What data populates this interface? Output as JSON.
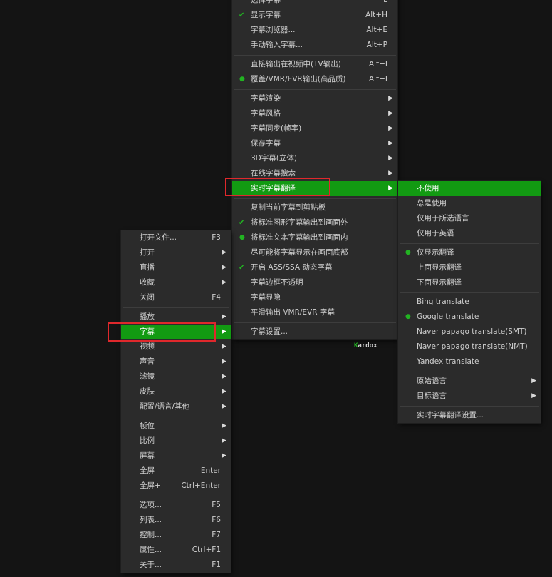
{
  "main_menu": {
    "items": [
      {
        "type": "item",
        "label": "打开文件...",
        "shortcut": "F3",
        "submenu": false,
        "name": "open-file"
      },
      {
        "type": "item",
        "label": "打开",
        "shortcut": "",
        "submenu": true,
        "name": "open"
      },
      {
        "type": "item",
        "label": "直播",
        "shortcut": "",
        "submenu": true,
        "name": "live"
      },
      {
        "type": "item",
        "label": "收藏",
        "shortcut": "",
        "submenu": true,
        "name": "favorites"
      },
      {
        "type": "item",
        "label": "关闭",
        "shortcut": "F4",
        "submenu": false,
        "name": "close"
      },
      {
        "type": "sep"
      },
      {
        "type": "item",
        "label": "播放",
        "shortcut": "",
        "submenu": true,
        "name": "playback"
      },
      {
        "type": "item",
        "label": "字幕",
        "shortcut": "",
        "submenu": true,
        "highlighted": true,
        "name": "subtitles"
      },
      {
        "type": "item",
        "label": "视频",
        "shortcut": "",
        "submenu": true,
        "name": "video"
      },
      {
        "type": "item",
        "label": "声音",
        "shortcut": "",
        "submenu": true,
        "name": "audio"
      },
      {
        "type": "item",
        "label": "滤镜",
        "shortcut": "",
        "submenu": true,
        "name": "filters"
      },
      {
        "type": "item",
        "label": "皮肤",
        "shortcut": "",
        "submenu": true,
        "name": "skins"
      },
      {
        "type": "item",
        "label": "配置/语言/其他",
        "shortcut": "",
        "submenu": true,
        "name": "config-language-other"
      },
      {
        "type": "sep"
      },
      {
        "type": "item",
        "label": "帧位",
        "shortcut": "",
        "submenu": true,
        "name": "frame-position"
      },
      {
        "type": "item",
        "label": "比例",
        "shortcut": "",
        "submenu": true,
        "name": "aspect-ratio"
      },
      {
        "type": "item",
        "label": "屏幕",
        "shortcut": "",
        "submenu": true,
        "name": "screen"
      },
      {
        "type": "item",
        "label": "全屏",
        "shortcut": "Enter",
        "submenu": false,
        "name": "fullscreen"
      },
      {
        "type": "item",
        "label": "全屏+",
        "shortcut": "Ctrl+Enter",
        "submenu": false,
        "name": "fullscreen-plus"
      },
      {
        "type": "sep"
      },
      {
        "type": "item",
        "label": "选项...",
        "shortcut": "F5",
        "submenu": false,
        "name": "options"
      },
      {
        "type": "item",
        "label": "列表...",
        "shortcut": "F6",
        "submenu": false,
        "name": "playlist"
      },
      {
        "type": "item",
        "label": "控制...",
        "shortcut": "F7",
        "submenu": false,
        "name": "control"
      },
      {
        "type": "item",
        "label": "属性...",
        "shortcut": "Ctrl+F1",
        "submenu": false,
        "name": "properties"
      },
      {
        "type": "item",
        "label": "关于...",
        "shortcut": "F1",
        "submenu": false,
        "name": "about"
      }
    ]
  },
  "subtitle_menu": {
    "items": [
      {
        "type": "item",
        "label": "选择字幕",
        "shortcut": "L",
        "submenu": false,
        "name": "select-subtitle"
      },
      {
        "type": "item",
        "label": "显示字幕",
        "shortcut": "Alt+H",
        "submenu": false,
        "marker": "check",
        "name": "show-subtitles"
      },
      {
        "type": "item",
        "label": "字幕浏览器...",
        "shortcut": "Alt+E",
        "submenu": false,
        "name": "subtitle-browser"
      },
      {
        "type": "item",
        "label": "手动输入字幕...",
        "shortcut": "Alt+P",
        "submenu": false,
        "name": "manual-subtitle-input"
      },
      {
        "type": "sep"
      },
      {
        "type": "item",
        "label": "直接输出在视频中(TV输出)",
        "shortcut": "Alt+I",
        "submenu": false,
        "name": "direct-output-tv"
      },
      {
        "type": "item",
        "label": "覆盖/VMR/EVR输出(高品质)",
        "shortcut": "Alt+I",
        "submenu": false,
        "marker": "dot",
        "name": "overlay-vmr-evr-output"
      },
      {
        "type": "sep"
      },
      {
        "type": "item",
        "label": "字幕渲染",
        "shortcut": "",
        "submenu": true,
        "name": "subtitle-rendering"
      },
      {
        "type": "item",
        "label": "字幕风格",
        "shortcut": "",
        "submenu": true,
        "name": "subtitle-style"
      },
      {
        "type": "item",
        "label": "字幕同步(帧率)",
        "shortcut": "",
        "submenu": true,
        "name": "subtitle-sync"
      },
      {
        "type": "item",
        "label": "保存字幕",
        "shortcut": "",
        "submenu": true,
        "name": "save-subtitle"
      },
      {
        "type": "item",
        "label": "3D字幕(立体)",
        "shortcut": "",
        "submenu": true,
        "name": "subtitle-3d"
      },
      {
        "type": "item",
        "label": "在线字幕搜索",
        "shortcut": "",
        "submenu": true,
        "name": "online-subtitle-search"
      },
      {
        "type": "item",
        "label": "实时字幕翻译",
        "shortcut": "",
        "submenu": true,
        "highlighted": true,
        "name": "realtime-subtitle-translation"
      },
      {
        "type": "sep"
      },
      {
        "type": "item",
        "label": "复制当前字幕到剪贴板",
        "shortcut": "",
        "submenu": false,
        "name": "copy-subtitle-clipboard"
      },
      {
        "type": "item",
        "label": "将标准图形字幕输出到画面外",
        "shortcut": "",
        "submenu": false,
        "marker": "check",
        "name": "graphic-subtitle-outside"
      },
      {
        "type": "item",
        "label": "将标准文本字幕输出到画面内",
        "shortcut": "",
        "submenu": false,
        "marker": "dot",
        "name": "text-subtitle-inside"
      },
      {
        "type": "item",
        "label": "尽可能将字幕显示在画面底部",
        "shortcut": "",
        "submenu": false,
        "name": "subtitle-at-bottom"
      },
      {
        "type": "item",
        "label": "开启 ASS/SSA 动态字幕",
        "shortcut": "",
        "submenu": false,
        "marker": "check",
        "name": "ass-ssa-dynamic"
      },
      {
        "type": "item",
        "label": "字幕边框不透明",
        "shortcut": "",
        "submenu": false,
        "name": "opaque-subtitle-border"
      },
      {
        "type": "item",
        "label": "字幕显隐",
        "shortcut": "",
        "submenu": false,
        "name": "subtitle-fade"
      },
      {
        "type": "item",
        "label": "平滑输出 VMR/EVR 字幕",
        "shortcut": "",
        "submenu": false,
        "name": "smooth-vmr-evr-subtitle"
      },
      {
        "type": "sep"
      },
      {
        "type": "item",
        "label": "字幕设置...",
        "shortcut": "",
        "submenu": false,
        "name": "subtitle-settings"
      }
    ]
  },
  "translate_menu": {
    "items": [
      {
        "type": "item",
        "label": "不使用",
        "shortcut": "",
        "submenu": false,
        "highlighted": true,
        "name": "not-used"
      },
      {
        "type": "item",
        "label": "总是使用",
        "shortcut": "",
        "submenu": false,
        "name": "always-use"
      },
      {
        "type": "item",
        "label": "仅用于所选语言",
        "shortcut": "",
        "submenu": false,
        "name": "selected-language-only"
      },
      {
        "type": "item",
        "label": "仅用于英语",
        "shortcut": "",
        "submenu": false,
        "name": "english-only"
      },
      {
        "type": "sep"
      },
      {
        "type": "item",
        "label": "仅显示翻译",
        "shortcut": "",
        "submenu": false,
        "marker": "dot",
        "name": "show-translation-only"
      },
      {
        "type": "item",
        "label": "上面显示翻译",
        "shortcut": "",
        "submenu": false,
        "name": "translation-above"
      },
      {
        "type": "item",
        "label": "下面显示翻译",
        "shortcut": "",
        "submenu": false,
        "name": "translation-below"
      },
      {
        "type": "sep"
      },
      {
        "type": "item",
        "label": "Bing translate",
        "shortcut": "",
        "submenu": false,
        "name": "bing-translate"
      },
      {
        "type": "item",
        "label": "Google translate",
        "shortcut": "",
        "submenu": false,
        "marker": "dot",
        "name": "google-translate"
      },
      {
        "type": "item",
        "label": "Naver papago translate(SMT)",
        "shortcut": "",
        "submenu": false,
        "name": "naver-papago-smt"
      },
      {
        "type": "item",
        "label": "Naver papago translate(NMT)",
        "shortcut": "",
        "submenu": false,
        "name": "naver-papago-nmt"
      },
      {
        "type": "item",
        "label": "Yandex translate",
        "shortcut": "",
        "submenu": false,
        "name": "yandex-translate"
      },
      {
        "type": "sep"
      },
      {
        "type": "item",
        "label": "原始语言",
        "shortcut": "",
        "submenu": true,
        "name": "source-language"
      },
      {
        "type": "item",
        "label": "目标语言",
        "shortcut": "",
        "submenu": true,
        "name": "target-language"
      },
      {
        "type": "sep"
      },
      {
        "type": "item",
        "label": "实时字幕翻译设置...",
        "shortcut": "",
        "submenu": false,
        "name": "translation-settings"
      }
    ]
  },
  "brand": {
    "first": "K",
    "rest": "ardox"
  },
  "colors": {
    "highlight": "#129a12",
    "check": "#22b322",
    "callout": "#e0282c",
    "menu_bg": "#2b2b2b"
  }
}
